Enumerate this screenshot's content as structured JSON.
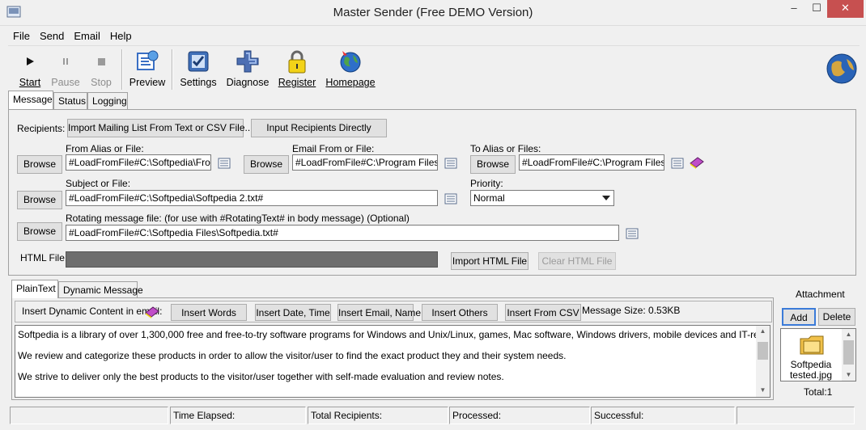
{
  "window": {
    "title": "Master Sender (Free DEMO Version)",
    "minimize": "–",
    "maximize": "☐",
    "close": "✕"
  },
  "menu": {
    "file": "File",
    "send": "Send",
    "email": "Email",
    "help": "Help"
  },
  "toolbar": {
    "start": "Start",
    "pause": "Pause",
    "stop": "Stop",
    "preview": "Preview",
    "settings": "Settings",
    "diagnose": "Diagnose",
    "register": "Register",
    "homepage": "Homepage"
  },
  "tabs": {
    "message": "Message",
    "status": "Status",
    "logging": "Logging"
  },
  "recipients": {
    "label": "Recipients:",
    "import_button": "Import Mailing List From Text or CSV File....",
    "direct_button": "Input Recipients Directly"
  },
  "browse_label": "Browse",
  "from_alias": {
    "label": "From Alias or File:",
    "value": "#LoadFromFile#C:\\Softpedia\\FromEr"
  },
  "email_from": {
    "label": "Email From or File:",
    "value": "#LoadFromFile#C:\\Program Files\\Ma"
  },
  "to_alias": {
    "label": "To Alias or Files:",
    "value": "#LoadFromFile#C:\\Program Files\\Ma"
  },
  "subject": {
    "label": "Subject or File:",
    "value": "#LoadFromFile#C:\\Softpedia\\Softpedia 2.txt#"
  },
  "priority": {
    "label": "Priority:",
    "value": "Normal"
  },
  "rotating": {
    "label": "Rotating message file: (for use with #RotatingText# in body message) (Optional)",
    "value": "#LoadFromFile#C:\\Softpedia Files\\Softpedia.txt#"
  },
  "html_file": {
    "label": "HTML File:",
    "import_button": "Import HTML File",
    "clear_button": "Clear HTML File"
  },
  "lower_tabs": {
    "plain": "PlainText",
    "dynamic": "Dynamic Message"
  },
  "dynamic": {
    "label": "Insert Dynamic Content in email:",
    "insert_words": "Insert Words",
    "insert_date": "Insert Date, Time",
    "insert_email": "Insert Email, Name",
    "insert_others": "Insert Others",
    "insert_csv": "Insert From CSV",
    "message_size": "Message Size: 0.53KB"
  },
  "body_lines": [
    "Softpedia is a library of over 1,300,000 free and free-to-try software programs for Windows and Unix/Linux, games, Mac software, Windows drivers, mobile devices and IT-related articles.",
    "We review and categorize these products in order to allow the visitor/user to find the exact product they and their system needs.",
    "We strive to deliver only the best products to the visitor/user together with self-made evaluation and review notes."
  ],
  "attachment": {
    "title": "Attachment",
    "add": "Add",
    "delete": "Delete",
    "file_name_1": "Softpedia",
    "file_name_2": "tested.jpg",
    "total": "Total:1"
  },
  "status": {
    "time_elapsed": "Time Elapsed:",
    "total_recipients": "Total Recipients:",
    "processed": "Processed:",
    "successful": "Successful:"
  },
  "colors": {
    "close_red": "#c75050",
    "html_field": "#6e6e6e"
  }
}
